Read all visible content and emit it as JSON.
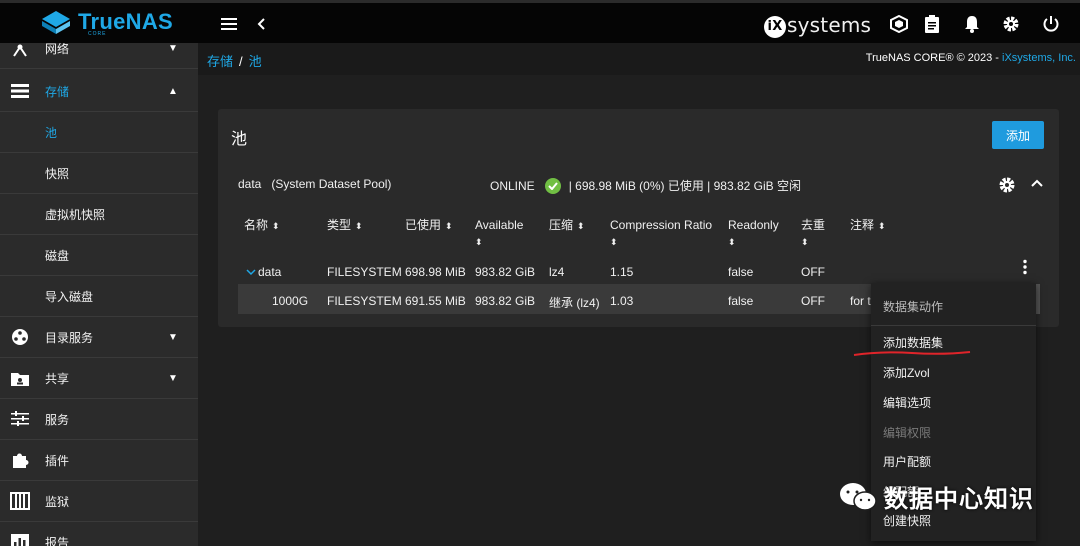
{
  "app": {
    "brand": "TrueNAS",
    "brand_sub": "CORE",
    "vendor_logo": "iXsystems",
    "accent_color": "#1fa8e6",
    "ok_color": "#71bf44"
  },
  "topbar": {
    "icons": [
      "menu-icon",
      "chevron-left-icon",
      "truecommand-icon",
      "clipboard-icon",
      "bell-icon",
      "gear-icon",
      "power-icon"
    ]
  },
  "sidebar": {
    "items": [
      {
        "label": "网络",
        "icon": "network-icon",
        "arrow": "▼"
      },
      {
        "label": "存储",
        "icon": "storage-icon",
        "arrow": "▲",
        "active": true
      },
      {
        "label": "池",
        "sub": true,
        "active": true
      },
      {
        "label": "快照",
        "sub": true
      },
      {
        "label": "虚拟机快照",
        "sub": true
      },
      {
        "label": "磁盘",
        "sub": true
      },
      {
        "label": "导入磁盘",
        "sub": true
      },
      {
        "label": "目录服务",
        "icon": "directory-icon",
        "arrow": "▼"
      },
      {
        "label": "共享",
        "icon": "share-icon",
        "arrow": "▼"
      },
      {
        "label": "服务",
        "icon": "services-icon"
      },
      {
        "label": "插件",
        "icon": "plugin-icon"
      },
      {
        "label": "监狱",
        "icon": "jail-icon"
      },
      {
        "label": "报告",
        "icon": "report-icon"
      }
    ]
  },
  "breadcrumb": {
    "parent": "存储",
    "sep": "/",
    "current": "池"
  },
  "copyright": {
    "text": "TrueNAS CORE® © 2023 - ",
    "link": "iXsystems, Inc."
  },
  "pool_card": {
    "title": "池",
    "add_label": "添加",
    "pool_name": "data   (System Dataset Pool)",
    "status": "ONLINE",
    "usage": "| 698.98 MiB (0%) 已使用 | 983.82 GiB 空闲"
  },
  "table": {
    "headers": [
      "名称",
      "类型",
      "已使用",
      "Available",
      "压缩",
      "Compression Ratio",
      "Readonly",
      "去重",
      "注释"
    ],
    "rows": [
      {
        "name": "data",
        "type": "FILESYSTEM",
        "used": "698.98 MiB",
        "available": "983.82 GiB",
        "compression": "lz4",
        "ratio": "1.15",
        "readonly": "false",
        "dedup": "OFF",
        "comment": ""
      },
      {
        "name": "1000G",
        "type": "FILESYSTEM",
        "used": "691.55 MiB",
        "available": "983.82 GiB",
        "compression": "继承 (lz4)",
        "ratio": "1.03",
        "readonly": "false",
        "dedup": "OFF",
        "comment": "for t"
      }
    ]
  },
  "dataset_menu": {
    "header": "数据集动作",
    "items": [
      {
        "label": "添加数据集",
        "disabled": false
      },
      {
        "label": "添加Zvol",
        "disabled": false
      },
      {
        "label": "编辑选项",
        "disabled": false
      },
      {
        "label": "编辑权限",
        "disabled": true
      },
      {
        "label": "用户配额",
        "disabled": false
      },
      {
        "label": "组配额",
        "disabled": false
      },
      {
        "label": "创建快照",
        "disabled": false
      }
    ]
  },
  "watermark": {
    "text": "数据中心知识",
    "icon": "wechat-icon"
  }
}
